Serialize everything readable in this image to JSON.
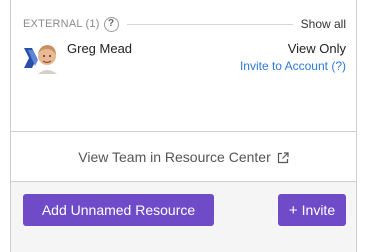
{
  "external": {
    "label": "EXTERNAL (1)",
    "help_icon": "?",
    "show_all": "Show all",
    "members": [
      {
        "name": "Greg Mead",
        "role": "View Only",
        "invite_link": "Invite to Account (?)"
      }
    ]
  },
  "view_team": {
    "label": "View Team in Resource Center",
    "icon": "external-link-icon"
  },
  "footer": {
    "add_button": "Add Unnamed Resource",
    "invite_plus": "+",
    "invite_button": "Invite"
  },
  "colors": {
    "accent": "#6f4bc8",
    "link": "#2f7ad9"
  }
}
